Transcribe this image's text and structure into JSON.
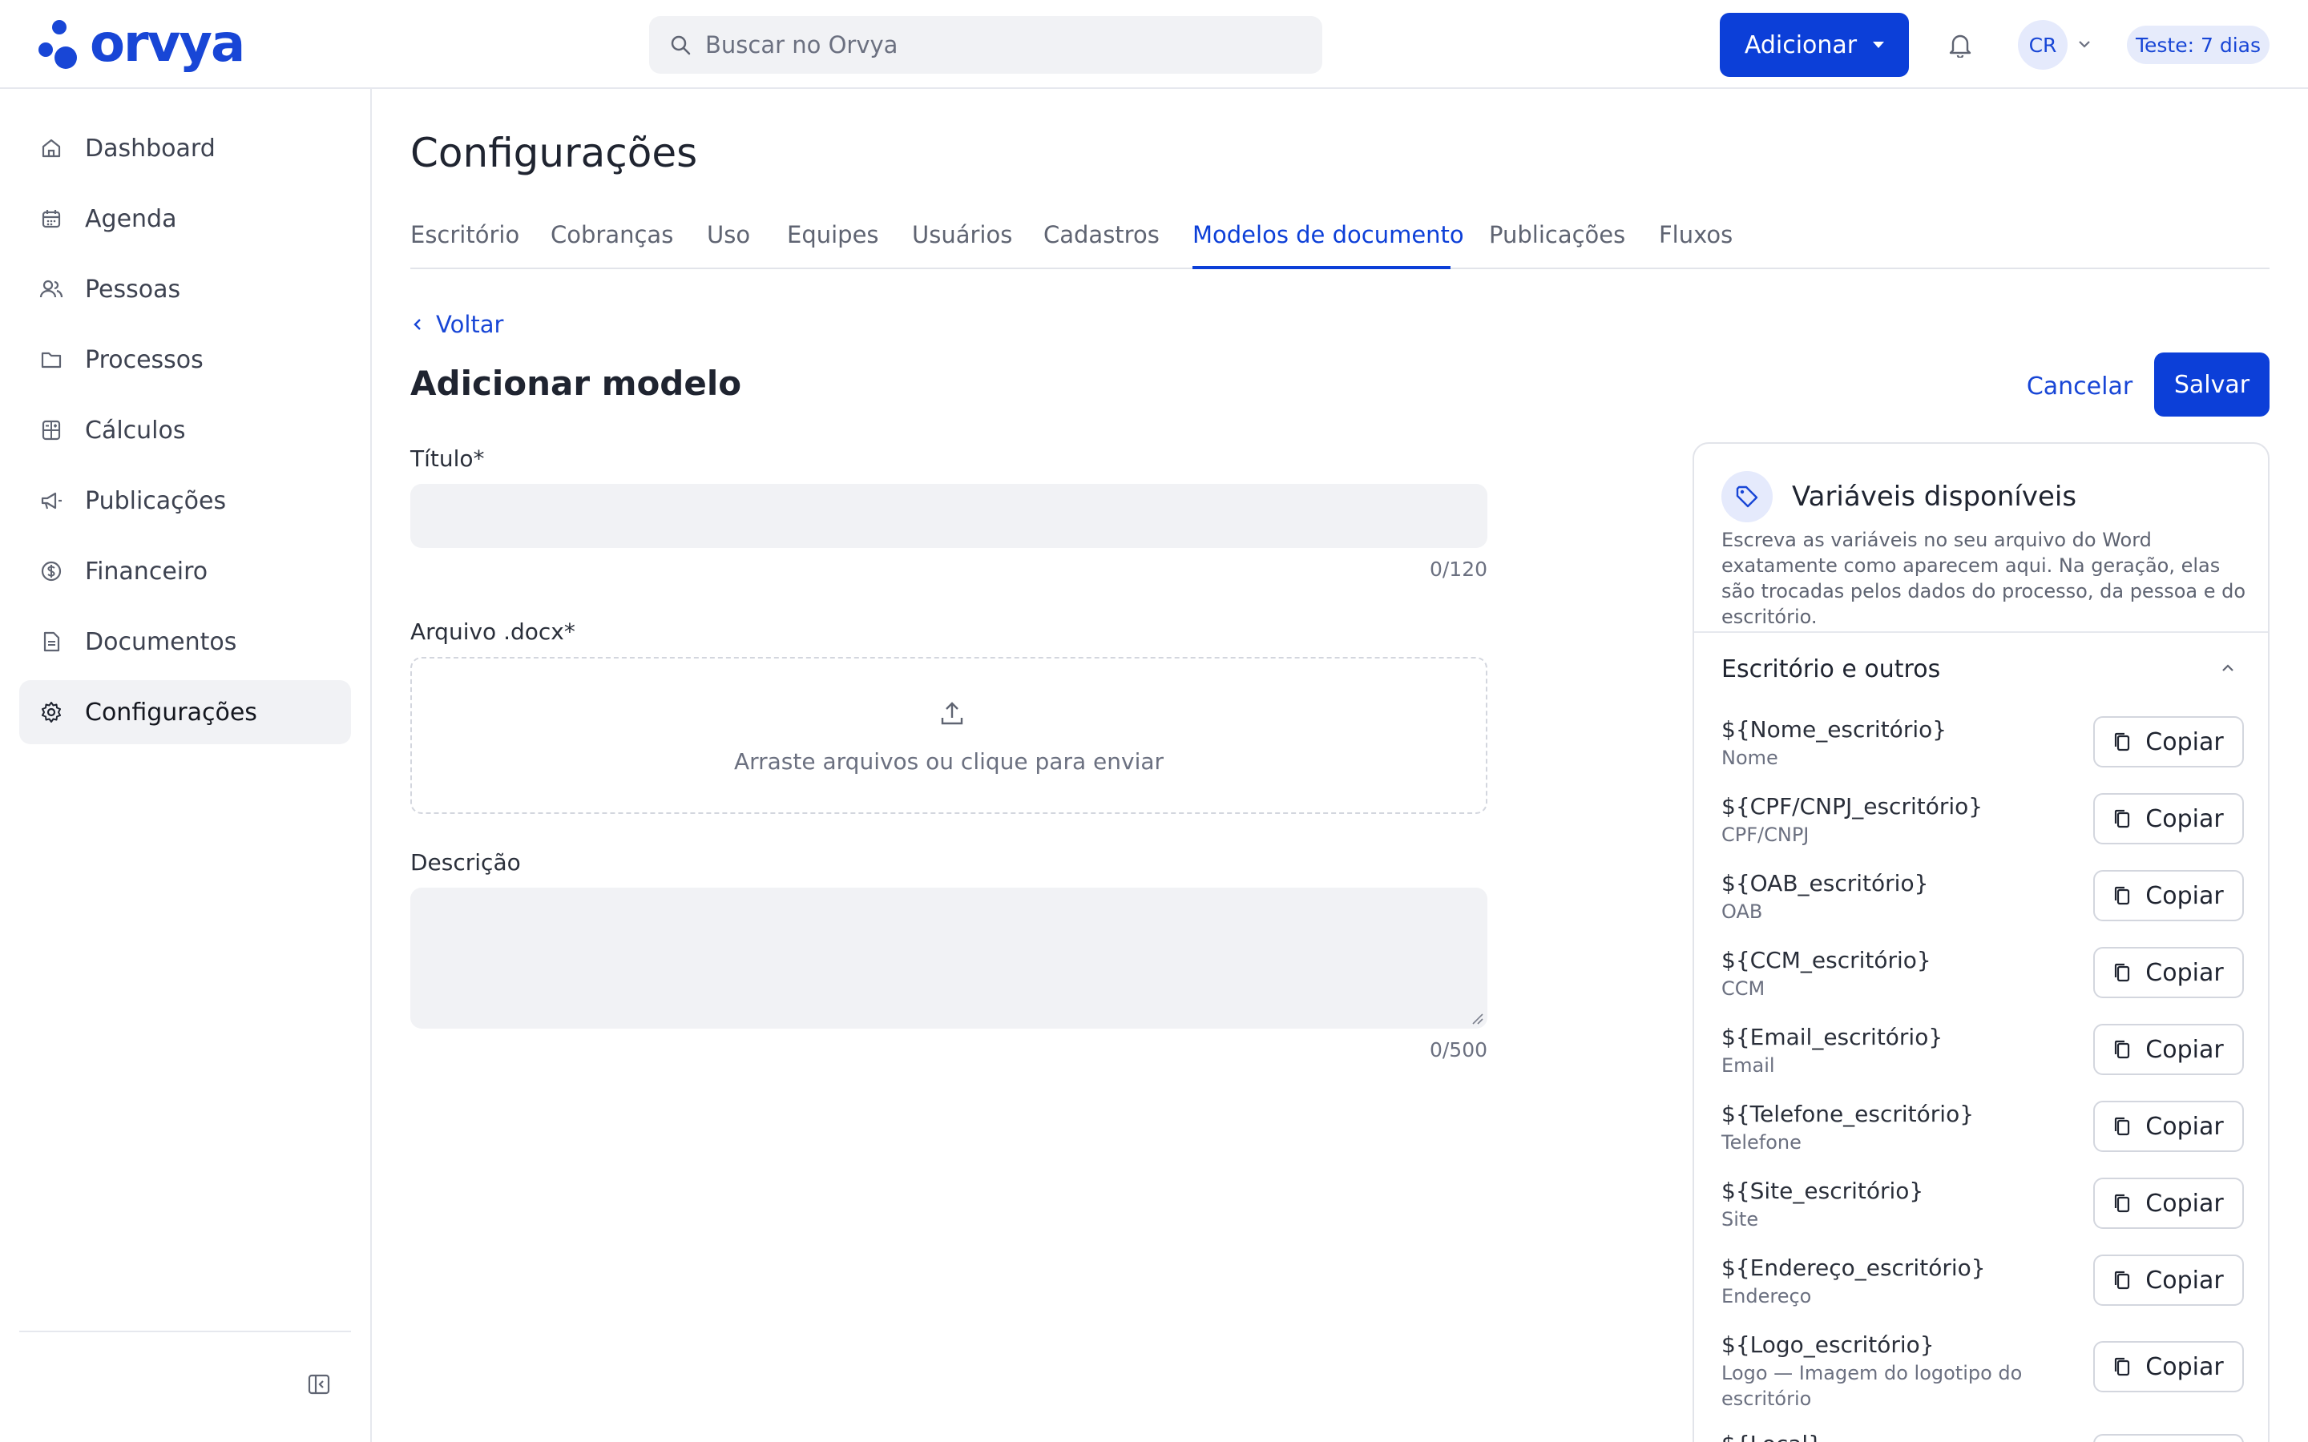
{
  "app": {
    "brand": "orvya",
    "search": {
      "placeholder": "Buscar no Orvya"
    },
    "add_button": "Adicionar",
    "avatar_initials": "CR",
    "trial_badge": "Teste: 7 dias"
  },
  "sidebar": {
    "items": [
      {
        "label": "Dashboard",
        "icon": "home-icon"
      },
      {
        "label": "Agenda",
        "icon": "calendar-icon"
      },
      {
        "label": "Pessoas",
        "icon": "people-icon"
      },
      {
        "label": "Processos",
        "icon": "folder-icon"
      },
      {
        "label": "Cálculos",
        "icon": "calculator-icon"
      },
      {
        "label": "Publicações",
        "icon": "megaphone-icon"
      },
      {
        "label": "Financeiro",
        "icon": "dollar-icon"
      },
      {
        "label": "Documentos",
        "icon": "document-icon"
      },
      {
        "label": "Configurações",
        "icon": "gear-icon",
        "active": true
      }
    ]
  },
  "page": {
    "title": "Configurações",
    "tabs": [
      {
        "label": "Escritório"
      },
      {
        "label": "Cobranças"
      },
      {
        "label": "Uso"
      },
      {
        "label": "Equipes"
      },
      {
        "label": "Usuários"
      },
      {
        "label": "Cadastros"
      },
      {
        "label": "Modelos de documento",
        "active": true
      },
      {
        "label": "Publicações"
      },
      {
        "label": "Fluxos"
      }
    ]
  },
  "form": {
    "back": "Voltar",
    "title": "Adicionar modelo",
    "cancel": "Cancelar",
    "save": "Salvar",
    "title_field": {
      "label": "Título*",
      "value": "",
      "counter": "0/120"
    },
    "file_field": {
      "label": "Arquivo .docx*",
      "dropzone_text": "Arraste arquivos ou clique para enviar"
    },
    "description_field": {
      "label": "Descrição",
      "value": "",
      "counter": "0/500"
    }
  },
  "variables": {
    "title": "Variáveis disponíveis",
    "description": "Escreva as variáveis no seu arquivo do Word exatamente como aparecem aqui. Na geração, elas são trocadas pelos dados do processo, da pessoa e do escritório.",
    "group_title": "Escritório e outros",
    "copy_label": "Copiar",
    "items": [
      {
        "code": "${Nome_escritório}",
        "caption": "Nome"
      },
      {
        "code": "${CPF/CNPJ_escritório}",
        "caption": "CPF/CNPJ"
      },
      {
        "code": "${OAB_escritório}",
        "caption": "OAB"
      },
      {
        "code": "${CCM_escritório}",
        "caption": "CCM"
      },
      {
        "code": "${Email_escritório}",
        "caption": "Email"
      },
      {
        "code": "${Telefone_escritório}",
        "caption": "Telefone"
      },
      {
        "code": "${Site_escritório}",
        "caption": "Site"
      },
      {
        "code": "${Endereço_escritório}",
        "caption": "Endereço"
      },
      {
        "code": "${Logo_escritório}",
        "caption": "Logo — Imagem do logotipo do escritório"
      },
      {
        "code": "${Local}",
        "caption": ""
      }
    ]
  },
  "colors": {
    "primary": "#0c3fd8",
    "primary_light": "#e5eafc",
    "input_bg": "#f1f2f5",
    "border": "#e2e4ea"
  }
}
